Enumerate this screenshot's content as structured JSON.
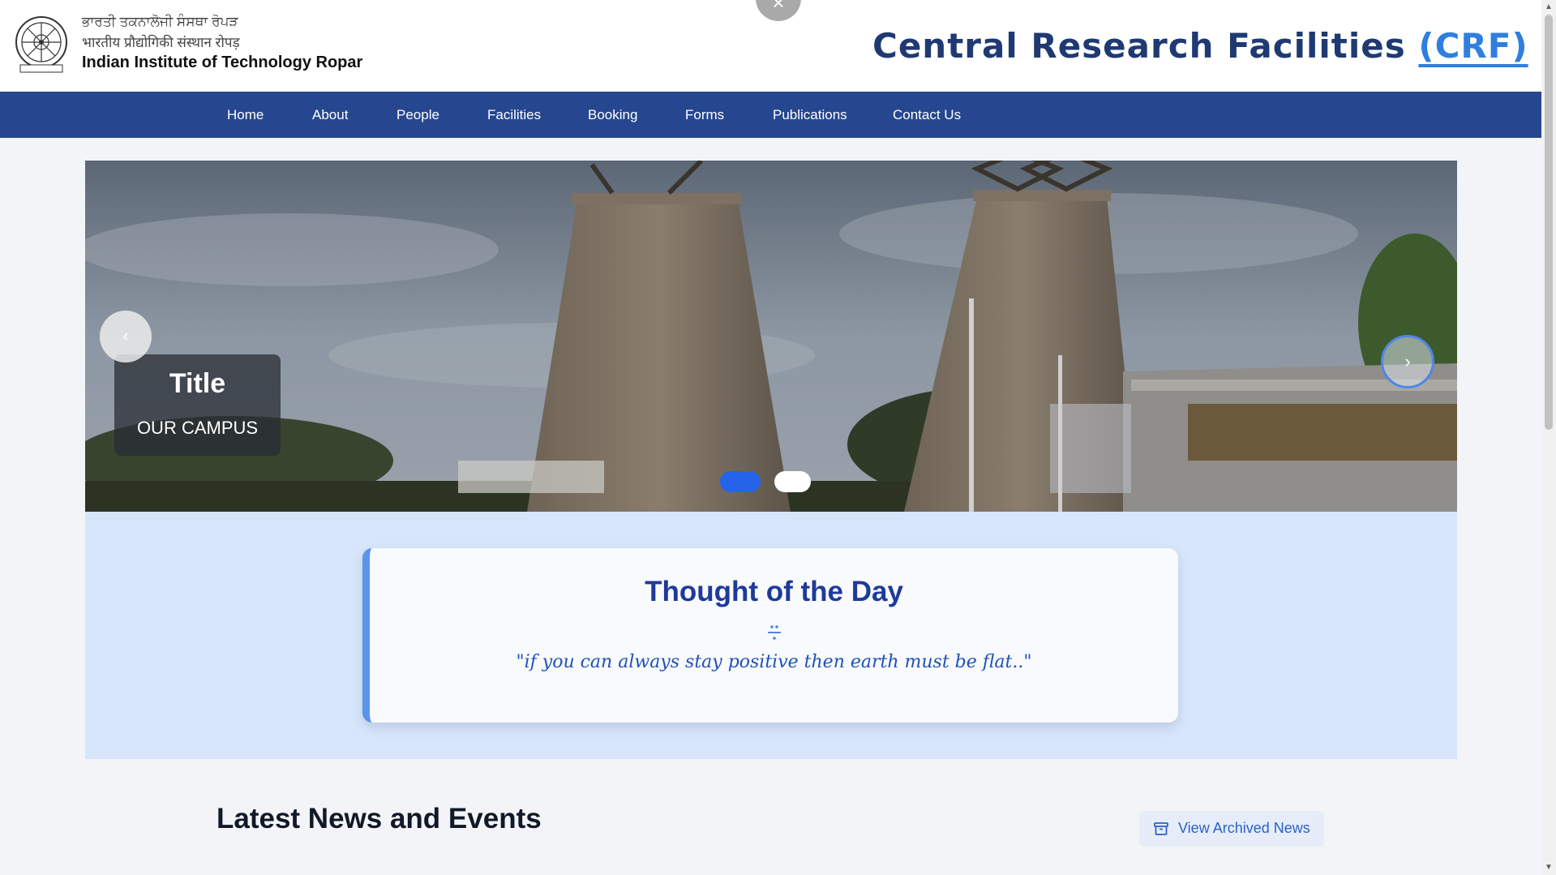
{
  "header": {
    "institute_hindi_1": "ਭਾਰਤੀ ਤਕਨਾਲੋਜੀ ਸੰਸਥਾ ਰੋਪੜ",
    "institute_hindi_2": "भारतीय प्रौद्योगिकी संस्थान रोपड़",
    "institute_name": "Indian Institute of Technology Ropar",
    "site_title": "Central Research Facilities",
    "site_abbr": "(CRF)",
    "close_label": "×"
  },
  "nav": {
    "items": [
      "Home",
      "About",
      "People",
      "Facilities",
      "Booking",
      "Forms",
      "Publications",
      "Contact Us"
    ]
  },
  "carousel": {
    "caption_title": "Title",
    "caption_text": "OUR CAMPUS",
    "prev_label": "‹",
    "next_label": "›",
    "slide_count": 2,
    "active_slide": 1
  },
  "thought": {
    "heading": "Thought of the Day",
    "quote": "\"if you can always stay positive then earth must be flat..\""
  },
  "news": {
    "heading": "Latest News and Events",
    "archive_button": "View Archived News"
  },
  "colors": {
    "nav_bg": "#26478f",
    "accent": "#2563eb",
    "title": "#1f3a72"
  }
}
